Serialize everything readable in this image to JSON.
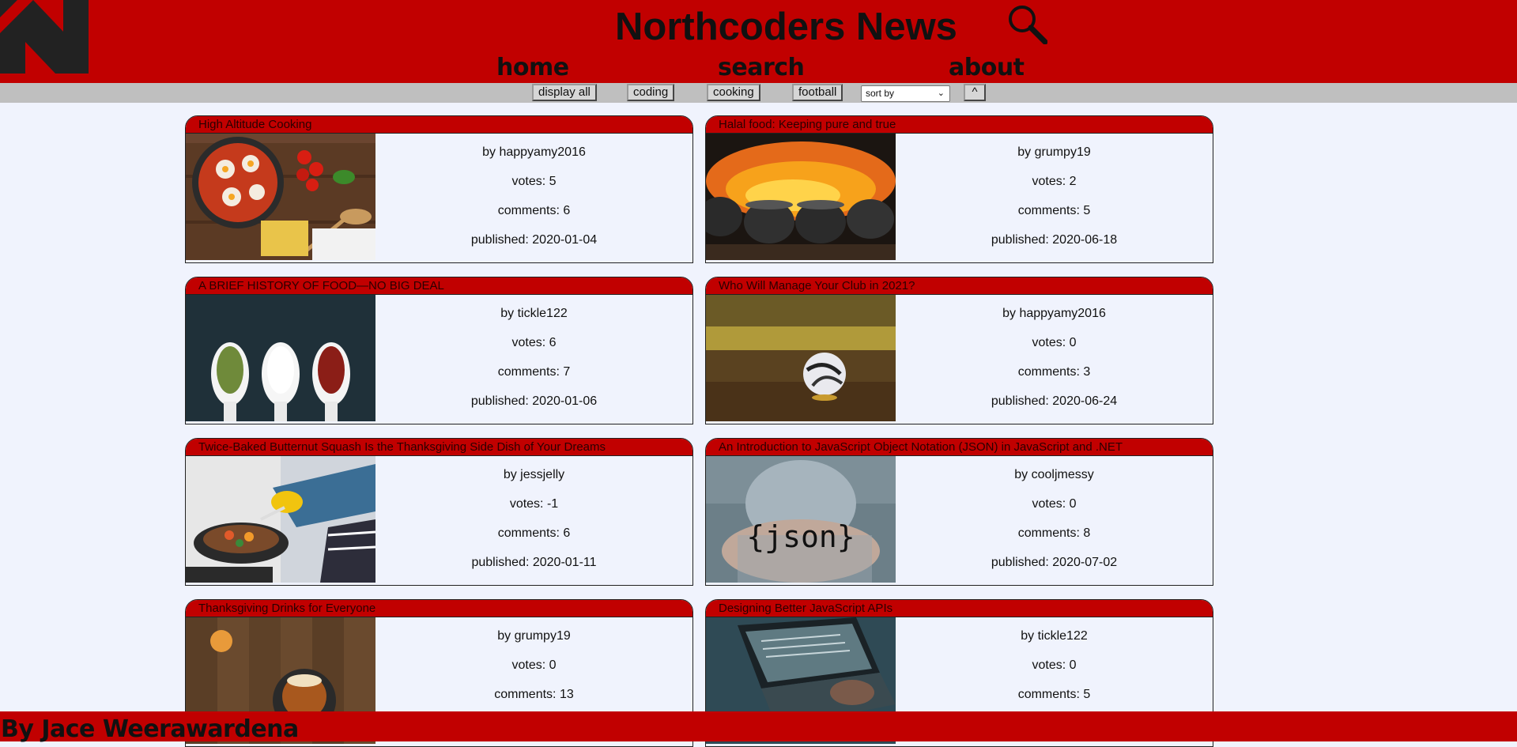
{
  "header": {
    "title": "Northcoders News",
    "nav": [
      "home",
      "search",
      "about"
    ]
  },
  "filters": {
    "buttons": [
      "display all",
      "coding",
      "cooking",
      "football"
    ],
    "sort_value": "sort by",
    "top_button": "^"
  },
  "articles": [
    {
      "title": "High Altitude Cooking",
      "author": "by happyamy2016",
      "votes": "votes: 5",
      "comments": "comments: 6",
      "published": "published: 2020-01-04"
    },
    {
      "title": "Halal food: Keeping pure and true",
      "author": "by grumpy19",
      "votes": "votes: 2",
      "comments": "comments: 5",
      "published": "published: 2020-06-18"
    },
    {
      "title": "A BRIEF HISTORY OF FOOD—NO BIG DEAL",
      "author": "by tickle122",
      "votes": "votes: 6",
      "comments": "comments: 7",
      "published": "published: 2020-01-06"
    },
    {
      "title": "Who Will Manage Your Club in 2021?",
      "author": "by happyamy2016",
      "votes": "votes: 0",
      "comments": "comments: 3",
      "published": "published: 2020-06-24"
    },
    {
      "title": "Twice-Baked Butternut Squash Is the Thanksgiving Side Dish of Your Dreams",
      "author": "by jessjelly",
      "votes": "votes: -1",
      "comments": "comments: 6",
      "published": "published: 2020-01-11"
    },
    {
      "title": "An Introduction to JavaScript Object Notation (JSON) in JavaScript and .NET",
      "author": "by cooljmessy",
      "votes": "votes: 0",
      "comments": "comments: 8",
      "published": "published: 2020-07-02",
      "image_text": "{json}"
    },
    {
      "title": "Thanksgiving Drinks for Everyone",
      "author": "by grumpy19",
      "votes": "votes: 0",
      "comments": "comments: 13",
      "published": ""
    },
    {
      "title": "Designing Better JavaScript APIs",
      "author": "by tickle122",
      "votes": "votes: 0",
      "comments": "comments: 5",
      "published": ""
    }
  ],
  "footer": {
    "text": "By Jace Weerawardena"
  },
  "colors": {
    "header_red": "#c10000",
    "background": "#f0f3fd",
    "filter_bar": "#bfbfbf"
  }
}
